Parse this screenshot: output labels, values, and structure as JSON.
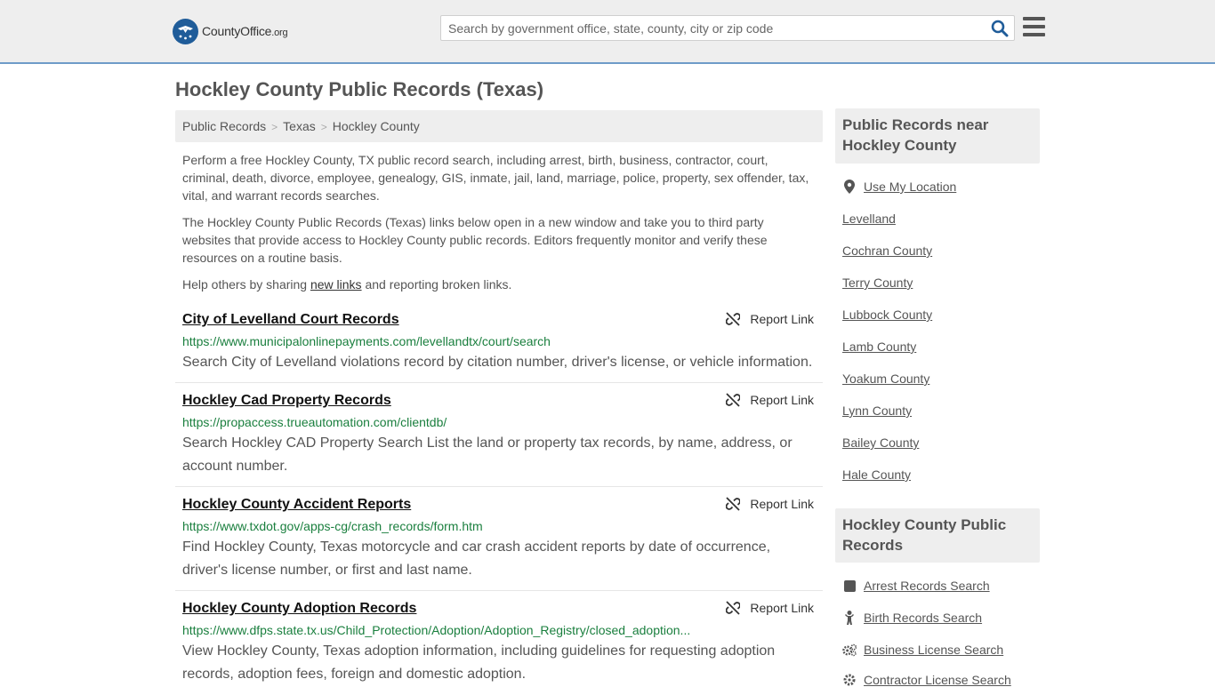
{
  "header": {
    "logo_text": "CountyOffice",
    "logo_suffix": ".org",
    "search_placeholder": "Search by government office, state, county, city or zip code"
  },
  "page_title": "Hockley County Public Records (Texas)",
  "breadcrumb": [
    "Public Records",
    "Texas",
    "Hockley County"
  ],
  "intro": {
    "p1": "Perform a free Hockley County, TX public record search, including arrest, birth, business, contractor, court, criminal, death, divorce, employee, genealogy, GIS, inmate, jail, land, marriage, police, property, sex offender, tax, vital, and warrant records searches.",
    "p2": "The Hockley County Public Records (Texas) links below open in a new window and take you to third party websites that provide access to Hockley County public records. Editors frequently monitor and verify these resources on a routine basis.",
    "p3_before": "Help others by sharing ",
    "p3_link": "new links",
    "p3_after": " and reporting broken links."
  },
  "report_label": "Report Link",
  "records": [
    {
      "title": "City of Levelland Court Records",
      "url": "https://www.municipalonlinepayments.com/levellandtx/court/search",
      "desc": "Search City of Levelland violations record by citation number, driver's license, or vehicle information."
    },
    {
      "title": "Hockley Cad Property Records",
      "url": "https://propaccess.trueautomation.com/clientdb/",
      "desc": "Search Hockley CAD Property Search List the land or property tax records, by name, address, or account number."
    },
    {
      "title": "Hockley County Accident Reports",
      "url": "https://www.txdot.gov/apps-cg/crash_records/form.htm",
      "desc": "Find Hockley County, Texas motorcycle and car crash accident reports by date of occurrence, driver's license number, or first and last name."
    },
    {
      "title": "Hockley County Adoption Records",
      "url": "https://www.dfps.state.tx.us/Child_Protection/Adoption/Adoption_Registry/closed_adoption...",
      "desc": "View Hockley County, Texas adoption information, including guidelines for requesting adoption records, adoption fees, foreign and domestic adoption."
    }
  ],
  "sidebar": {
    "near_title": "Public Records near Hockley County",
    "use_location": "Use My Location",
    "near_links": [
      "Levelland",
      "Cochran County",
      "Terry County",
      "Lubbock County",
      "Lamb County",
      "Yoakum County",
      "Lynn County",
      "Bailey County",
      "Hale County"
    ],
    "records_title": "Hockley County Public Records",
    "record_links": [
      {
        "label": "Arrest Records Search",
        "icon": "square-icon"
      },
      {
        "label": "Birth Records Search",
        "icon": "baby-icon"
      },
      {
        "label": "Business License Search",
        "icon": "gears-icon"
      },
      {
        "label": "Contractor License Search",
        "icon": "gear-icon"
      }
    ]
  }
}
